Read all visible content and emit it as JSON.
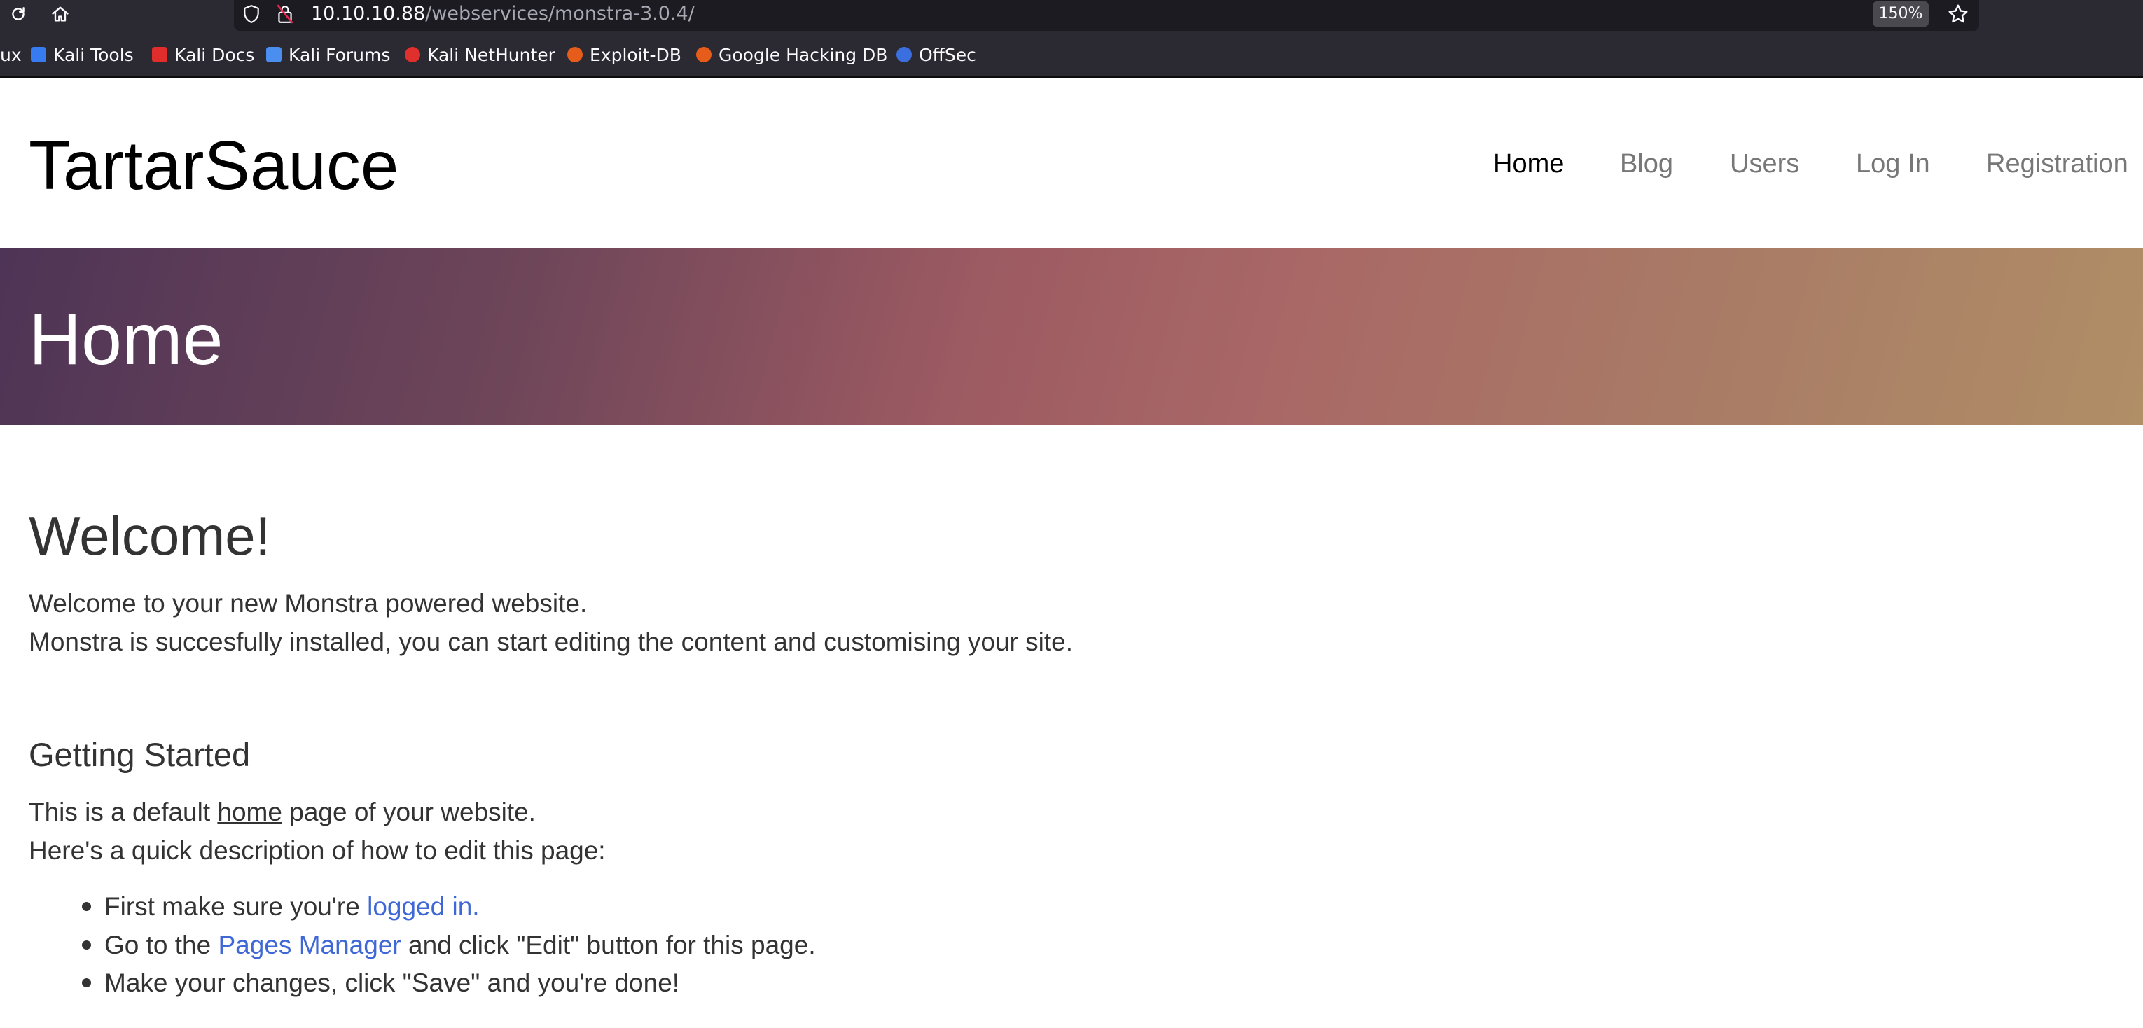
{
  "browser": {
    "url_host": "10.10.10.88",
    "url_path": "/webservices/monstra-3.0.4/",
    "zoom": "150%",
    "bookmarks": [
      {
        "label": "ux",
        "icon": "overflow-icon",
        "color": "#fbfbfe"
      },
      {
        "label": "Kali Tools",
        "icon": "kali-tools-icon",
        "color": "#367bf0"
      },
      {
        "label": "Kali Docs",
        "icon": "kali-docs-icon",
        "color": "#e22d2d"
      },
      {
        "label": "Kali Forums",
        "icon": "kali-forums-icon",
        "color": "#4a8ff0"
      },
      {
        "label": "Kali NetHunter",
        "icon": "kali-nethunter-icon",
        "color": "#e0302d"
      },
      {
        "label": "Exploit-DB",
        "icon": "exploit-db-icon",
        "color": "#e65c1a"
      },
      {
        "label": "Google Hacking DB",
        "icon": "ghdb-icon",
        "color": "#e65c1a"
      },
      {
        "label": "OffSec",
        "icon": "offsec-icon",
        "color": "#3b6fe0"
      }
    ]
  },
  "site": {
    "title": "TartarSauce",
    "nav": [
      {
        "label": "Home",
        "active": true
      },
      {
        "label": "Blog",
        "active": false
      },
      {
        "label": "Users",
        "active": false
      },
      {
        "label": "Log In",
        "active": false
      },
      {
        "label": "Registration",
        "active": false
      }
    ],
    "banner_title": "Home"
  },
  "content": {
    "welcome_heading": "Welcome!",
    "welcome_line1": "Welcome to your new Monstra powered website.",
    "welcome_line2": "Monstra is succesfully installed, you can start editing the content and customising your site.",
    "started_heading": "Getting Started",
    "default_pre": "This is a default ",
    "default_link": "home",
    "default_post": " page of your website.",
    "quick_desc": "Here's a quick description of how to edit this page:",
    "steps": [
      {
        "pre": "First make sure you're ",
        "link": "logged in.",
        "post": ""
      },
      {
        "pre": "Go to the ",
        "link": "Pages Manager",
        "post": " and click \"Edit\" button for this page."
      },
      {
        "pre": "Make your changes, click \"Save\" and you're done!",
        "link": "",
        "post": ""
      }
    ]
  },
  "colors": {
    "link": "#3f68d6",
    "nav_active": "#000000",
    "nav_inactive": "#777777",
    "banner_gradient_start": "#4e3456",
    "banner_gradient_end": "#b08e66"
  }
}
